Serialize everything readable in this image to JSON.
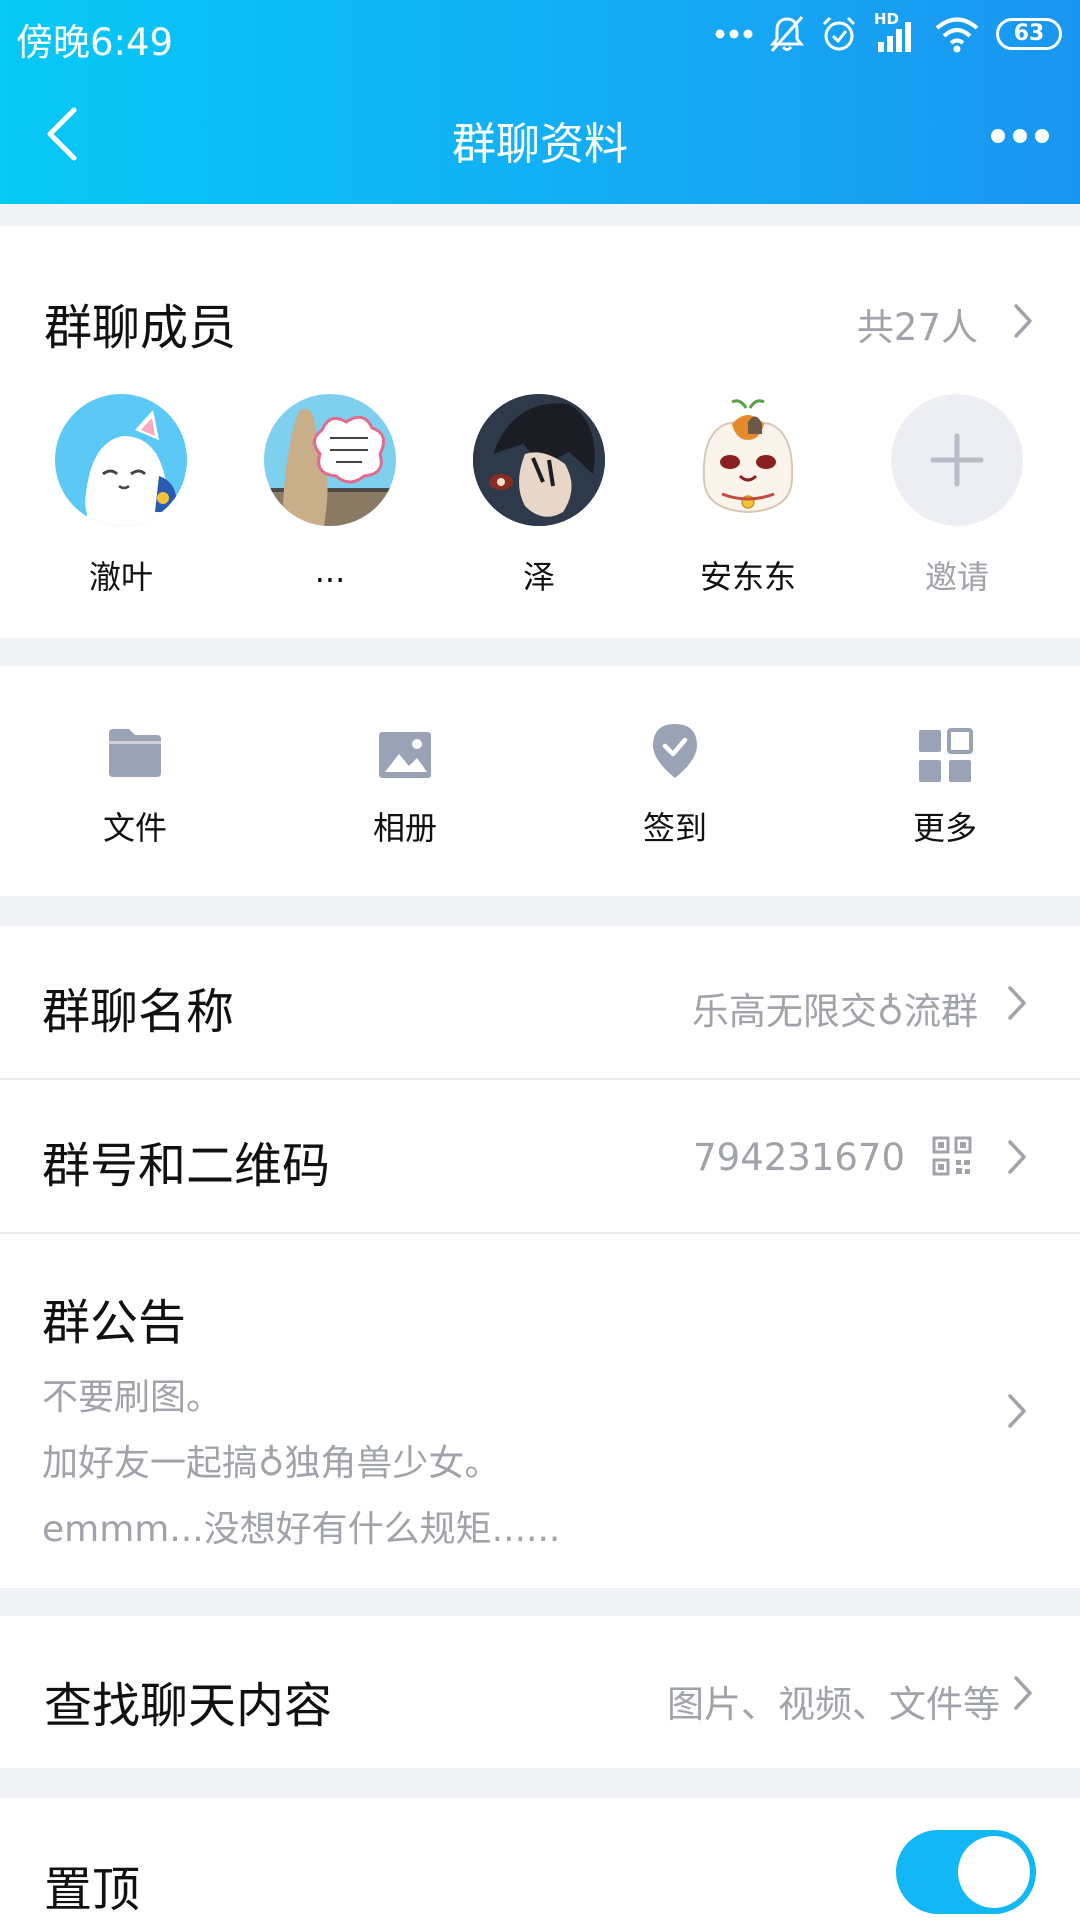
{
  "status_bar": {
    "time": "傍晚6:49",
    "battery": "63",
    "network_label": "HD",
    "icons": [
      "more-dots-icon",
      "bell-muted-icon",
      "alarm-icon",
      "signal-icon",
      "wifi-icon",
      "battery-icon"
    ]
  },
  "header": {
    "title": "群聊资料",
    "back_icon": "back-chevron-icon",
    "menu_icon": "more-horizontal-icon"
  },
  "members": {
    "title": "群聊成员",
    "count": "共27人",
    "items": [
      {
        "name": "澈叶",
        "avatar": "white-cat-avatar"
      },
      {
        "name": "...",
        "avatar": "meme-photo-avatar"
      },
      {
        "name": "泽",
        "avatar": "anime-character-avatar"
      },
      {
        "name": "安东东",
        "avatar": "nyanko-sensei-avatar"
      }
    ],
    "invite_label": "邀请"
  },
  "tools": [
    {
      "label": "文件",
      "icon": "folder-icon"
    },
    {
      "label": "相册",
      "icon": "image-icon"
    },
    {
      "label": "签到",
      "icon": "checkin-pin-icon"
    },
    {
      "label": "更多",
      "icon": "grid-icon"
    }
  ],
  "group_name": {
    "label": "群聊名称",
    "value": "乐高无限交♁流群"
  },
  "group_id": {
    "label": "群号和二维码",
    "value": "794231670",
    "icon": "qr-code-icon"
  },
  "notice": {
    "label": "群公告",
    "lines": [
      "不要刷图。",
      "加好友一起搞♁独角兽少女。",
      "emmm...没想好有什么规矩......"
    ]
  },
  "search": {
    "label": "查找聊天内容",
    "value": "图片、视频、文件等"
  },
  "pin": {
    "label": "置顶",
    "enabled": true
  },
  "colors": {
    "accent": "#12b7f5",
    "secondary_text": "#a1a3aa",
    "background": "#f1f2f6"
  }
}
